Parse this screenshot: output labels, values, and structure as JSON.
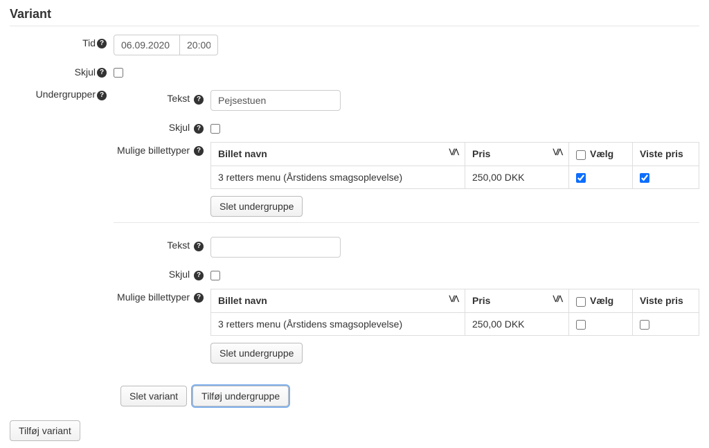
{
  "section": {
    "title": "Variant"
  },
  "labels": {
    "tid": "Tid",
    "skjul": "Skjul",
    "undergrupper": "Undergrupper",
    "tekst": "Tekst",
    "mulige_billettyper": "Mulige billettyper"
  },
  "fields": {
    "date": "06.09.2020",
    "time": "20:00",
    "variant_skjul": false
  },
  "table_headers": {
    "billet_navn": "Billet navn",
    "pris": "Pris",
    "vaelg": "Vælg",
    "viste_pris": "Viste pris"
  },
  "subgroups": [
    {
      "tekst": "Pejsestuen",
      "skjul": false,
      "header_select_all": false,
      "rows": [
        {
          "navn": "3 retters menu (Årstidens smagsoplevelse)",
          "pris": "250,00 DKK",
          "valgt": true,
          "viste_pris": true
        }
      ]
    },
    {
      "tekst": "",
      "skjul": false,
      "header_select_all": false,
      "rows": [
        {
          "navn": "3 retters menu (Årstidens smagsoplevelse)",
          "pris": "250,00 DKK",
          "valgt": false,
          "viste_pris": false
        }
      ]
    }
  ],
  "buttons": {
    "slet_undergruppe": "Slet undergruppe",
    "slet_variant": "Slet variant",
    "tilfoj_undergruppe": "Tilføj undergruppe",
    "tilfoj_variant": "Tilføj variant"
  }
}
